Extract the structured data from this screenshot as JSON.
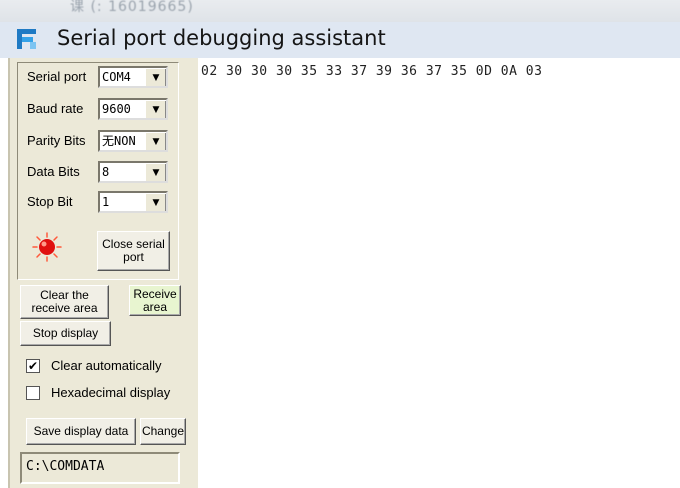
{
  "window": {
    "title": "Serial port debugging assistant"
  },
  "settings": [
    {
      "label": "Serial port",
      "value": "COM4"
    },
    {
      "label": "Baud rate",
      "value": "9600"
    },
    {
      "label": "Parity Bits",
      "value": "无NON"
    },
    {
      "label": "Data Bits",
      "value": "8"
    },
    {
      "label": "Stop Bit",
      "value": "1"
    }
  ],
  "port": {
    "indicator_color": "#e01010",
    "button_label": "Close serial port"
  },
  "controls": {
    "clear_receive_label": "Clear the receive area",
    "receive_area_label": "Receive area",
    "stop_display_label": "Stop display",
    "clear_auto_label": "Clear automatically",
    "clear_auto_checked": true,
    "hex_display_label": "Hexadecimal display",
    "hex_display_checked": false,
    "save_label": "Save display data",
    "change_label": "Change",
    "save_path": "C:\\COMDATA"
  },
  "receive": {
    "text": "02 30 30 30 35 33 37 39 36 37 35 0D 0A 03"
  }
}
